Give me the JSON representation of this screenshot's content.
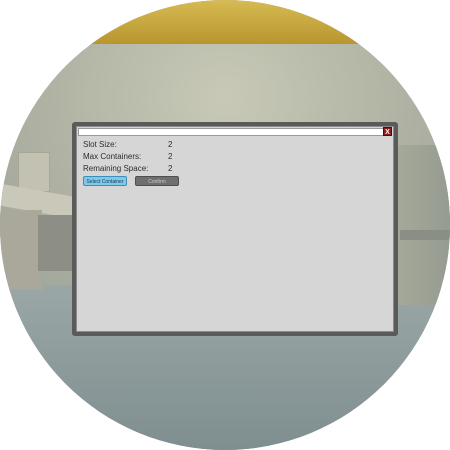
{
  "panel": {
    "close_label": "X",
    "rows": [
      {
        "label": "Slot Size:",
        "value": "2"
      },
      {
        "label": "Max Containers:",
        "value": "2"
      },
      {
        "label": "Remaining Space:",
        "value": "2"
      }
    ],
    "select_label": "Select Container",
    "confirm_label": "Confirm"
  },
  "colors": {
    "select_button": "#7cc9ec",
    "confirm_button": "#6f6f6f",
    "close_button": "#8a1d1d",
    "panel_background": "#d6d6d6",
    "panel_border": "#5a5a5a"
  }
}
